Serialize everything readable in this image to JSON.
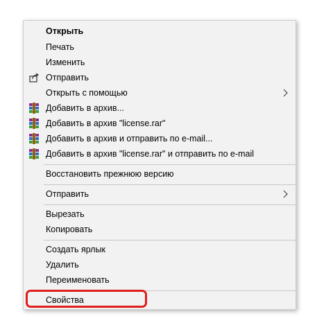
{
  "context_menu": {
    "items": [
      {
        "label": "Открыть"
      },
      {
        "label": "Печать"
      },
      {
        "label": "Изменить"
      },
      {
        "label": "Отправить",
        "icon": "share-icon"
      },
      {
        "label": "Открыть с помощью",
        "submenu": true
      },
      {
        "label": "Добавить в архив...",
        "icon": "winrar-icon"
      },
      {
        "label": "Добавить в архив \"license.rar\"",
        "icon": "winrar-icon"
      },
      {
        "label": "Добавить в архив и отправить по e-mail...",
        "icon": "winrar-icon"
      },
      {
        "label": "Добавить в архив \"license.rar\" и отправить по e-mail",
        "icon": "winrar-icon"
      },
      {
        "label": "Восстановить прежнюю версию"
      },
      {
        "label": "Отправить",
        "submenu": true
      },
      {
        "label": "Вырезать"
      },
      {
        "label": "Копировать"
      },
      {
        "label": "Создать ярлык"
      },
      {
        "label": "Удалить"
      },
      {
        "label": "Переименовать"
      },
      {
        "label": "Свойства"
      }
    ]
  },
  "colors": {
    "menu_background": "#f2f2f2",
    "separator": "#c8c8c8",
    "highlight_outline": "#e01d1d"
  }
}
